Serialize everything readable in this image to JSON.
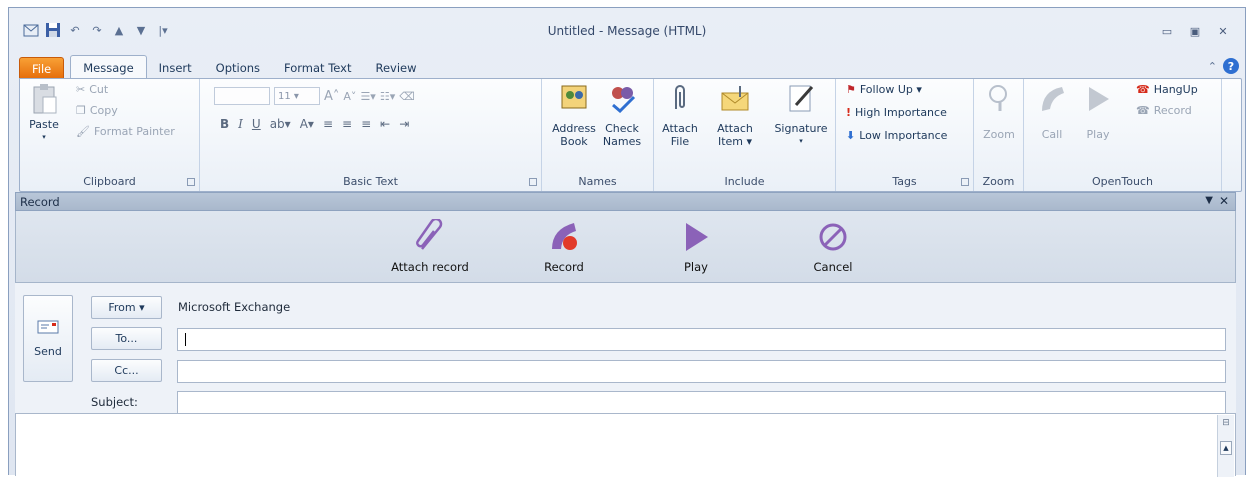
{
  "window": {
    "title": "Untitled - Message (HTML)"
  },
  "tabs": [
    "File",
    "Message",
    "Insert",
    "Options",
    "Format Text",
    "Review"
  ],
  "clipboard": {
    "paste": "Paste",
    "cut": "Cut",
    "copy": "Copy",
    "format_painter": "Format Painter",
    "label": "Clipboard"
  },
  "basic_text": {
    "font_size": "11",
    "label": "Basic Text"
  },
  "names": {
    "address_book_1": "Address",
    "address_book_2": "Book",
    "check_names_1": "Check",
    "check_names_2": "Names",
    "label": "Names"
  },
  "include": {
    "attach_file_1": "Attach",
    "attach_file_2": "File",
    "attach_item_1": "Attach",
    "attach_item_2": "Item ▾",
    "signature": "Signature",
    "label": "Include"
  },
  "tags": {
    "follow_up": "Follow Up ▾",
    "high": "High Importance",
    "low": "Low Importance",
    "label": "Tags"
  },
  "zoom": {
    "button": "Zoom",
    "label": "Zoom"
  },
  "opentouch": {
    "call": "Call",
    "play": "Play",
    "hangup": "HangUp",
    "record": "Record",
    "label": "OpenTouch"
  },
  "record_pane": {
    "title": "Record",
    "attach": "Attach record",
    "record": "Record",
    "play": "Play",
    "cancel": "Cancel"
  },
  "form": {
    "send": "Send",
    "from": "From ▾",
    "from_value": "Microsoft Exchange",
    "to": "To...",
    "cc": "Cc...",
    "subject": "Subject:"
  }
}
